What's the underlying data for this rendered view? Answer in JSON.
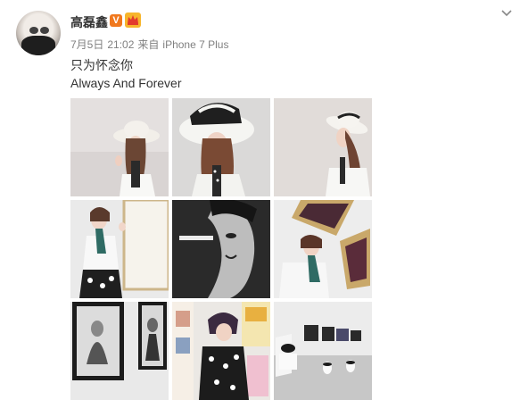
{
  "post": {
    "username": "高磊鑫",
    "verified_badge": "V",
    "vip_icon": "crown-badge-icon",
    "date": "7月5日",
    "time": "21:02",
    "source_prefix": "来自",
    "source_device": "iPhone 7 Plus",
    "text_line1": "只为怀念你",
    "text_line2": "Always And Forever",
    "menu_icon": "chevron-down-icon"
  },
  "photos": [
    {
      "name": "photo-1",
      "scene": "white-hat-portrait"
    },
    {
      "name": "photo-2",
      "scene": "black-white-hat-portrait"
    },
    {
      "name": "photo-3",
      "scene": "hat-profile-portrait"
    },
    {
      "name": "photo-4",
      "scene": "woman-by-frame"
    },
    {
      "name": "photo-5",
      "scene": "monochrome-face-poster"
    },
    {
      "name": "photo-6",
      "scene": "woman-with-art-frames"
    },
    {
      "name": "photo-7",
      "scene": "framed-photographs-wall"
    },
    {
      "name": "photo-8",
      "scene": "woman-in-gallery"
    },
    {
      "name": "photo-9",
      "scene": "gallery-room"
    }
  ],
  "colors": {
    "text": "#333333",
    "meta": "#808080",
    "verified": "#f0781e",
    "vip": "#f7b52c"
  }
}
